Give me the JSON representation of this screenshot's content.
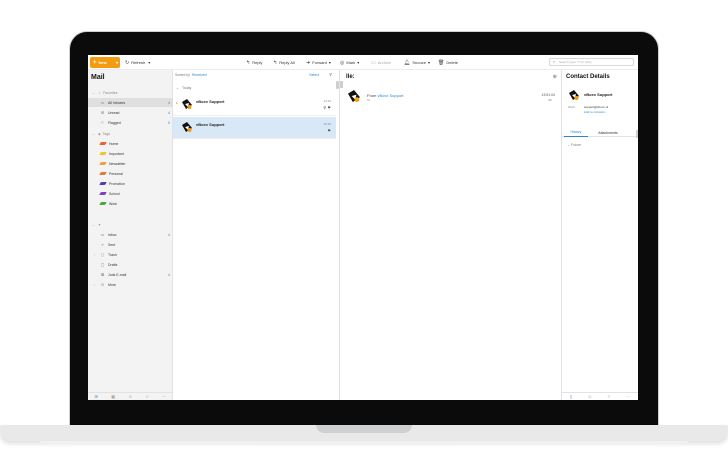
{
  "toolbar": {
    "new_label": "New",
    "refresh_label": "Refresh",
    "reply_label": "Reply",
    "reply_all_label": "Reply All",
    "forward_label": "Forward",
    "mark_label": "Mark",
    "archive_label": "Archive",
    "snooze_label": "Snooze",
    "delete_label": "Delete",
    "search_placeholder": "Search (type '?' for help)"
  },
  "sidebar": {
    "title": "Mail",
    "favorites_label": "Favorites",
    "favorites": [
      {
        "label": "All Inboxes",
        "count": "4"
      },
      {
        "label": "Unread",
        "count": "4"
      },
      {
        "label": "Flagged",
        "count": "0"
      }
    ],
    "tags_label": "Tags",
    "tags": [
      {
        "label": "Home",
        "color": "#e8622a"
      },
      {
        "label": "Important",
        "color": "#f2c12e"
      },
      {
        "label": "Newsletter",
        "color": "#f2a03d"
      },
      {
        "label": "Personal",
        "color": "#e07b2c"
      },
      {
        "label": "Promotion",
        "color": "#4a3fbf"
      },
      {
        "label": "School",
        "color": "#7b3fbf"
      },
      {
        "label": "Work",
        "color": "#4aa83f"
      }
    ],
    "folders": [
      {
        "label": "Inbox",
        "count": "4"
      },
      {
        "label": "Sent"
      },
      {
        "label": "Trash"
      },
      {
        "label": "Drafts"
      },
      {
        "label": "Junk E-mail",
        "count": "4"
      },
      {
        "label": "More"
      }
    ]
  },
  "list": {
    "sorted_prefix": "Sorted by",
    "sorted_by": "Received",
    "select_label": "Select",
    "group_label": "Today",
    "messages": [
      {
        "from": "vBoxx Support",
        "time": "14:10"
      },
      {
        "from": "vBoxx Support",
        "time": "13:20"
      }
    ]
  },
  "reader": {
    "subject": "lle:",
    "from_prefix": "From",
    "from_name": "vBoxx Support",
    "to": "To",
    "time": "13:51:04",
    "meta": "8K"
  },
  "contact": {
    "title": "Contact Details",
    "name": "vBoxx Support",
    "work_label": "Work",
    "email": "support@vboxx.nl",
    "add_label": "Add to contacts...",
    "tabs": [
      "History",
      "Attachments"
    ],
    "future_label": "Future"
  },
  "colors": {
    "accent": "#f39c12",
    "link": "#2a86d1",
    "selection": "#d9e8f7"
  }
}
